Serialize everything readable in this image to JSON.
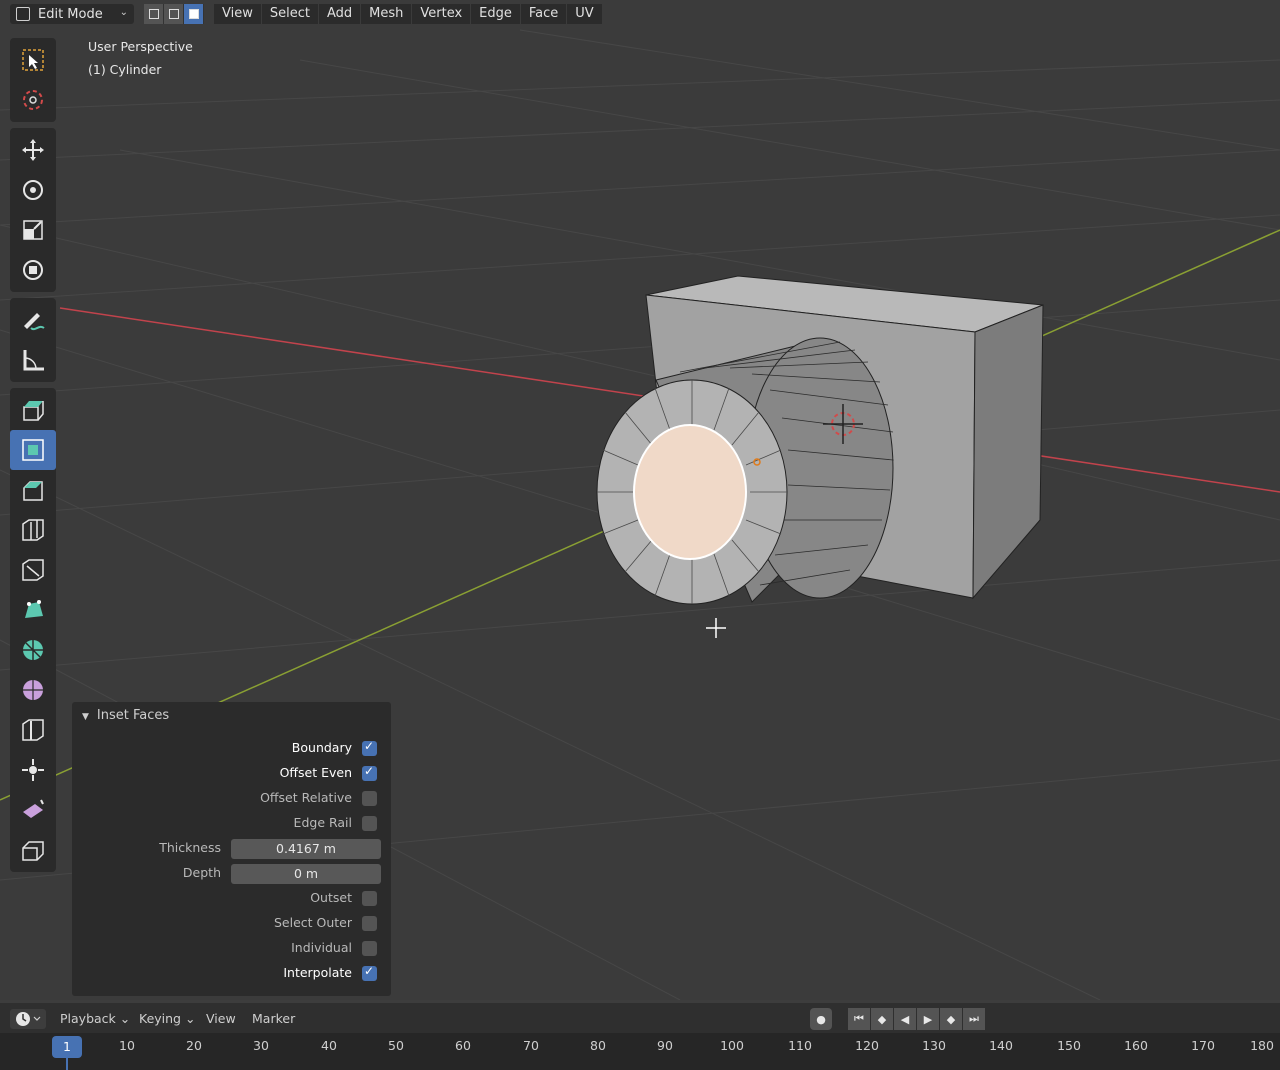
{
  "header": {
    "mode": "Edit Mode",
    "menu": [
      "View",
      "Select",
      "Add",
      "Mesh",
      "Vertex",
      "Edge",
      "Face",
      "UV"
    ],
    "select_mode_active": "face"
  },
  "viewport": {
    "view_name": "User Perspective",
    "object_name": "(1) Cylinder"
  },
  "toolbar": {
    "active_tool": "inset-faces",
    "tools": [
      "select-box",
      "cursor",
      "move",
      "rotate",
      "scale",
      "transform",
      "annotate",
      "measure",
      "extrude-region",
      "inset-faces",
      "bevel",
      "loop-cut",
      "knife",
      "poly-build",
      "spin",
      "smooth",
      "edge-slide",
      "shrink-fatten",
      "shear",
      "rip-region"
    ]
  },
  "operator_panel": {
    "title": "Inset Faces",
    "options": [
      {
        "label": "Boundary",
        "checked": true
      },
      {
        "label": "Offset Even",
        "checked": true
      },
      {
        "label": "Offset Relative",
        "checked": false
      },
      {
        "label": "Edge Rail",
        "checked": false
      }
    ],
    "thickness_label": "Thickness",
    "thickness_value": "0.4167 m",
    "depth_label": "Depth",
    "depth_value": "0 m",
    "options2": [
      {
        "label": "Outset",
        "checked": false
      },
      {
        "label": "Select Outer",
        "checked": false
      },
      {
        "label": "Individual",
        "checked": false
      },
      {
        "label": "Interpolate",
        "checked": true
      }
    ]
  },
  "timeline": {
    "menu": [
      "Playback",
      "Keying",
      "View",
      "Marker"
    ],
    "current_frame": "1",
    "frame_labels": [
      "10",
      "20",
      "30",
      "40",
      "50",
      "60",
      "70",
      "80",
      "90",
      "100",
      "110",
      "120",
      "130",
      "140",
      "150",
      "160",
      "170",
      "180"
    ]
  },
  "colors": {
    "accent": "#4772b3",
    "inset_face": "#f0d9c8",
    "x_axis": "#c2434c",
    "y_axis": "#8aa033"
  }
}
